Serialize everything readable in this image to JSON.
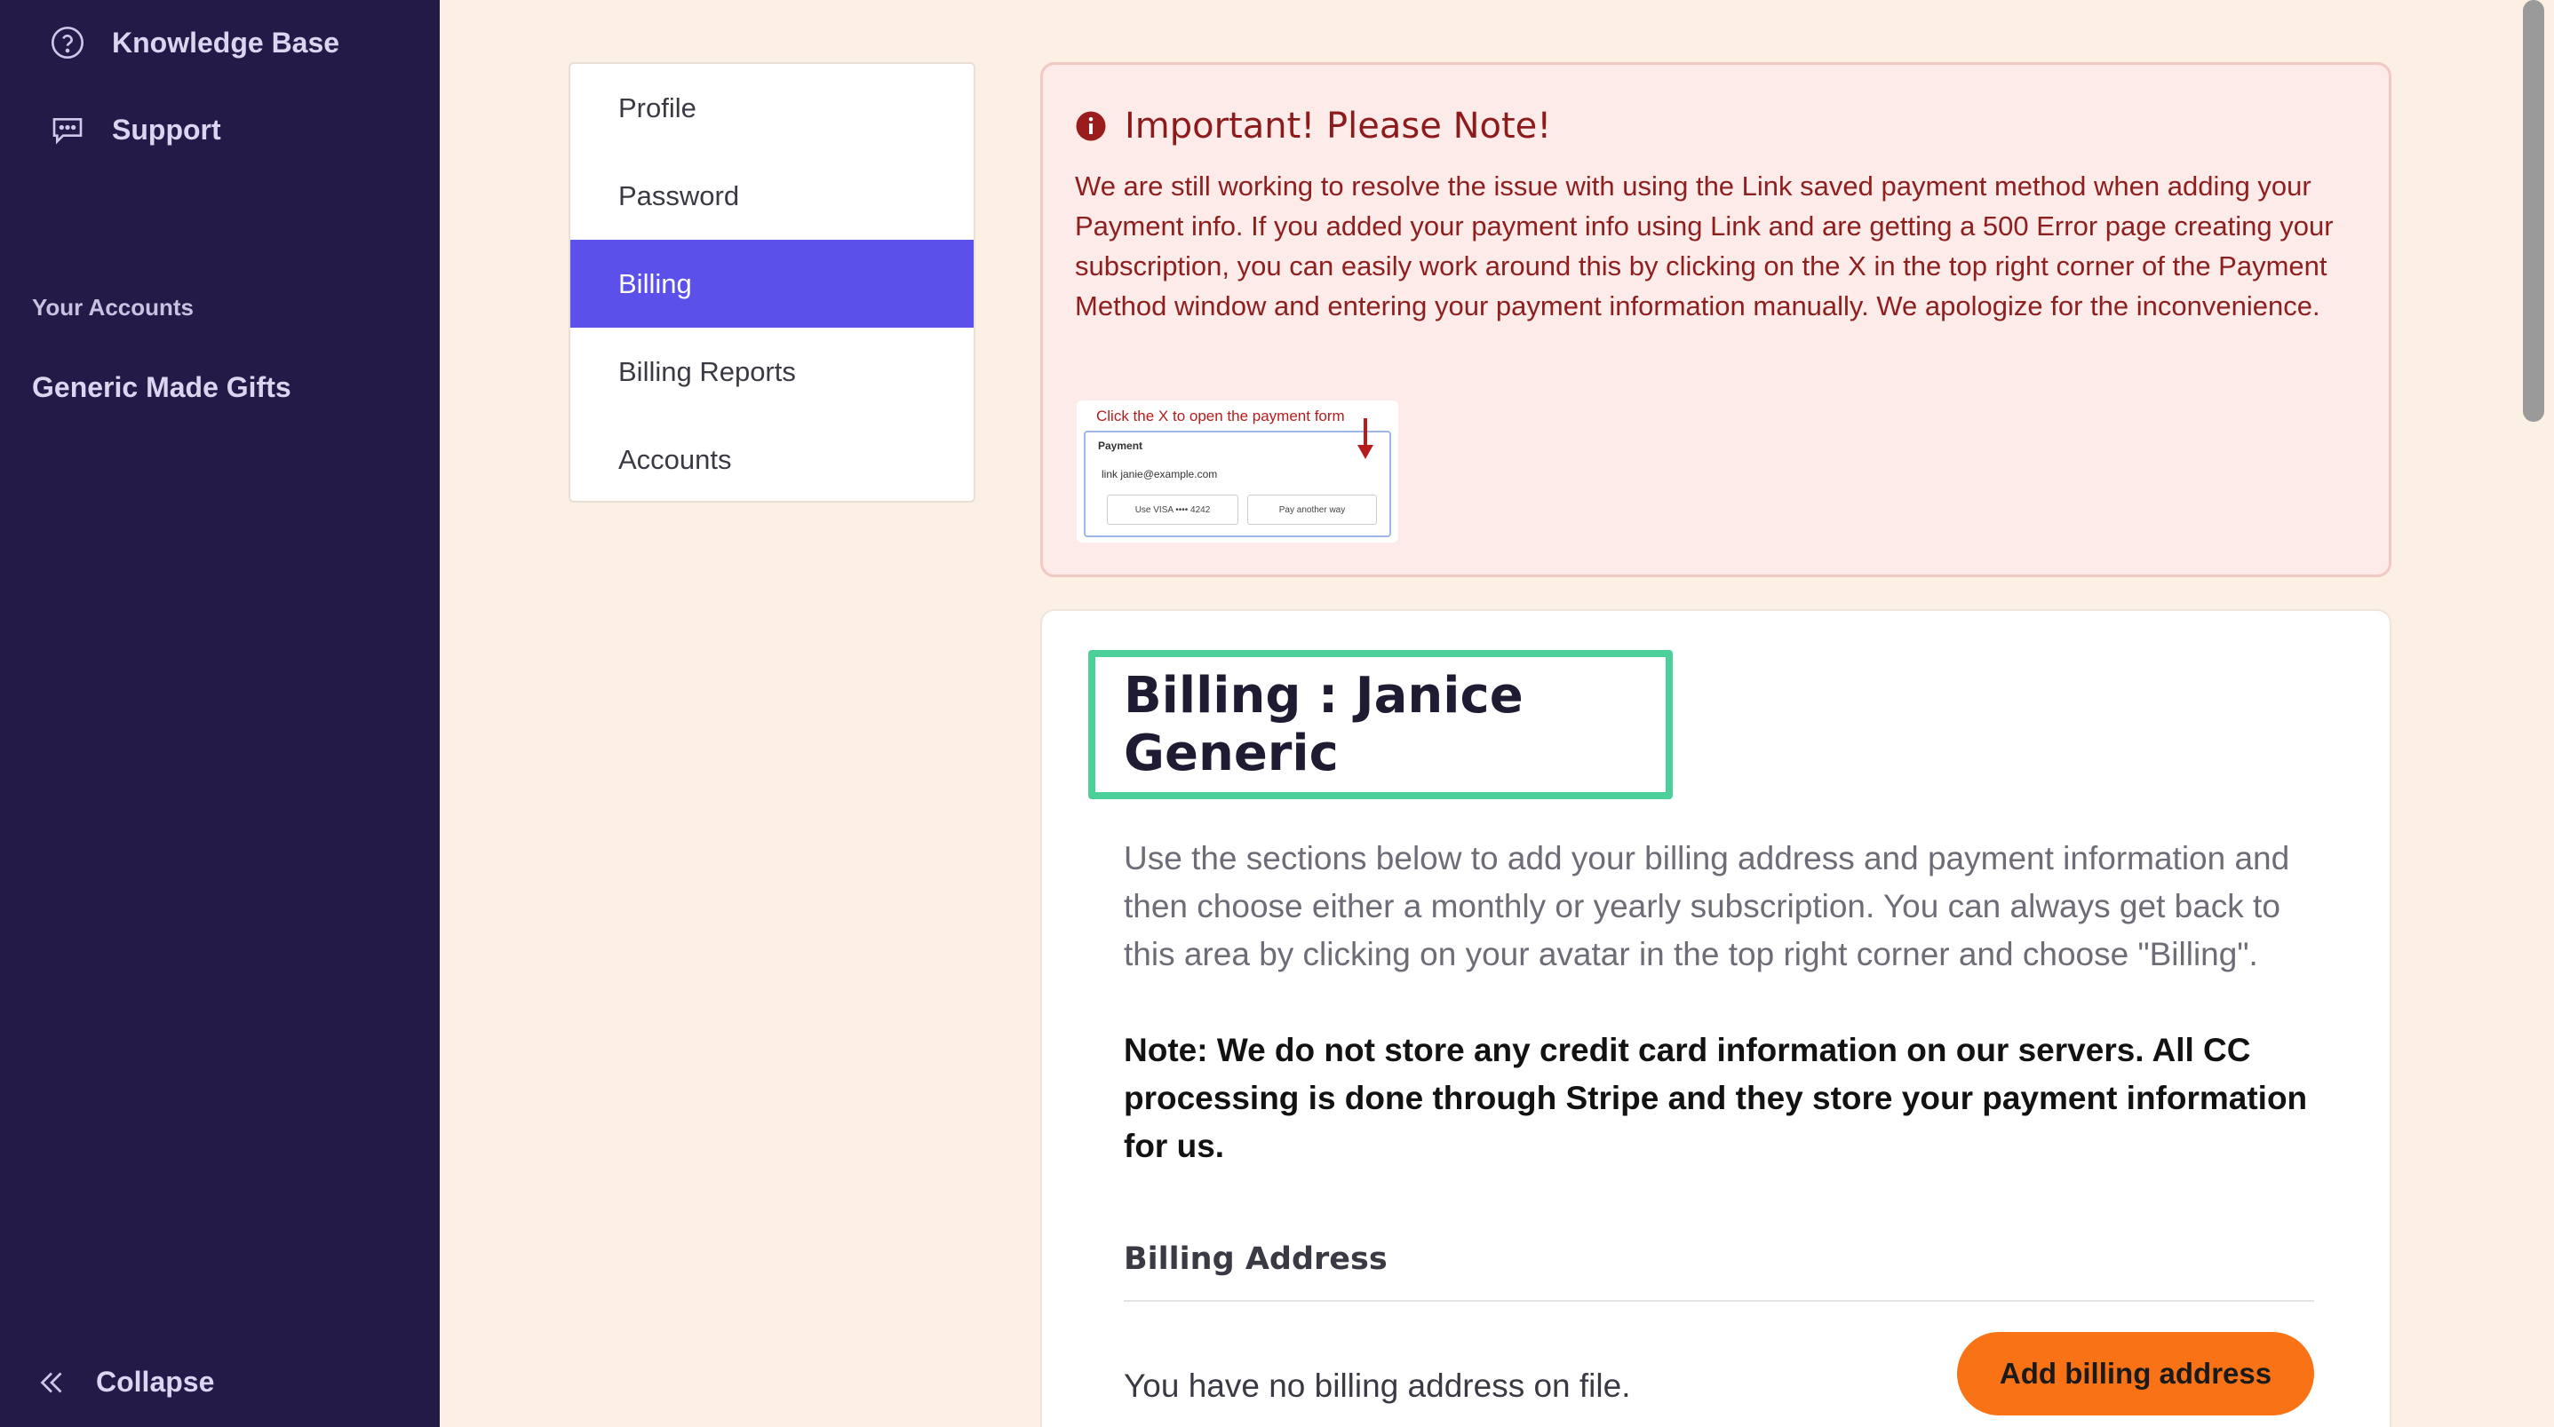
{
  "sidebar": {
    "knowledge_base": "Knowledge Base",
    "support": "Support",
    "accounts_heading": "Your Accounts",
    "account_name": "Generic Made Gifts",
    "collapse": "Collapse"
  },
  "settings_nav": {
    "items": [
      {
        "label": "Profile"
      },
      {
        "label": "Password"
      },
      {
        "label": "Billing",
        "active": true
      },
      {
        "label": "Billing Reports"
      },
      {
        "label": "Accounts"
      }
    ]
  },
  "alert": {
    "title": "Important! Please Note!",
    "body": "We are still working to resolve the issue with using the Link saved payment method when adding your Payment info. If you added your payment info using Link and are getting a 500 Error page creating your subscription, you can easily work around this by clicking on the X in the top right corner of the Payment Method window and entering your payment information manually. We apologize for the inconvenience.",
    "image": {
      "caption": "Click the X to open the payment form",
      "label": "Payment",
      "link_line": "link  janie@example.com",
      "use_button": "Use  VISA  •••• 4242",
      "other_button": "Pay another way"
    }
  },
  "billing": {
    "title": "Billing : Janice Generic",
    "intro": "Use the sections below to add your billing address and payment information and then choose either a monthly or yearly subscription. You can always get back to this area by clicking on your avatar in the top right corner and choose \"Billing\".",
    "note": "Note: We do not store any credit card information on our servers. All CC processing is done through Stripe and they store your payment information for us.",
    "address_heading": "Billing Address",
    "no_address": "You have no billing address on file.",
    "add_button": "Add billing address"
  },
  "colors": {
    "sidebar_bg": "#231a48",
    "active_nav": "#5b50ea",
    "alert_text": "#8c1c1c",
    "title_outline": "#4bd09a",
    "primary_button": "#f97316",
    "page_bg": "#fcefe4"
  },
  "icons": {
    "knowledge_base": "question-circle-icon",
    "support": "chat-bubble-icon",
    "collapse": "double-chevron-left-icon",
    "alert": "info-circle-icon"
  }
}
